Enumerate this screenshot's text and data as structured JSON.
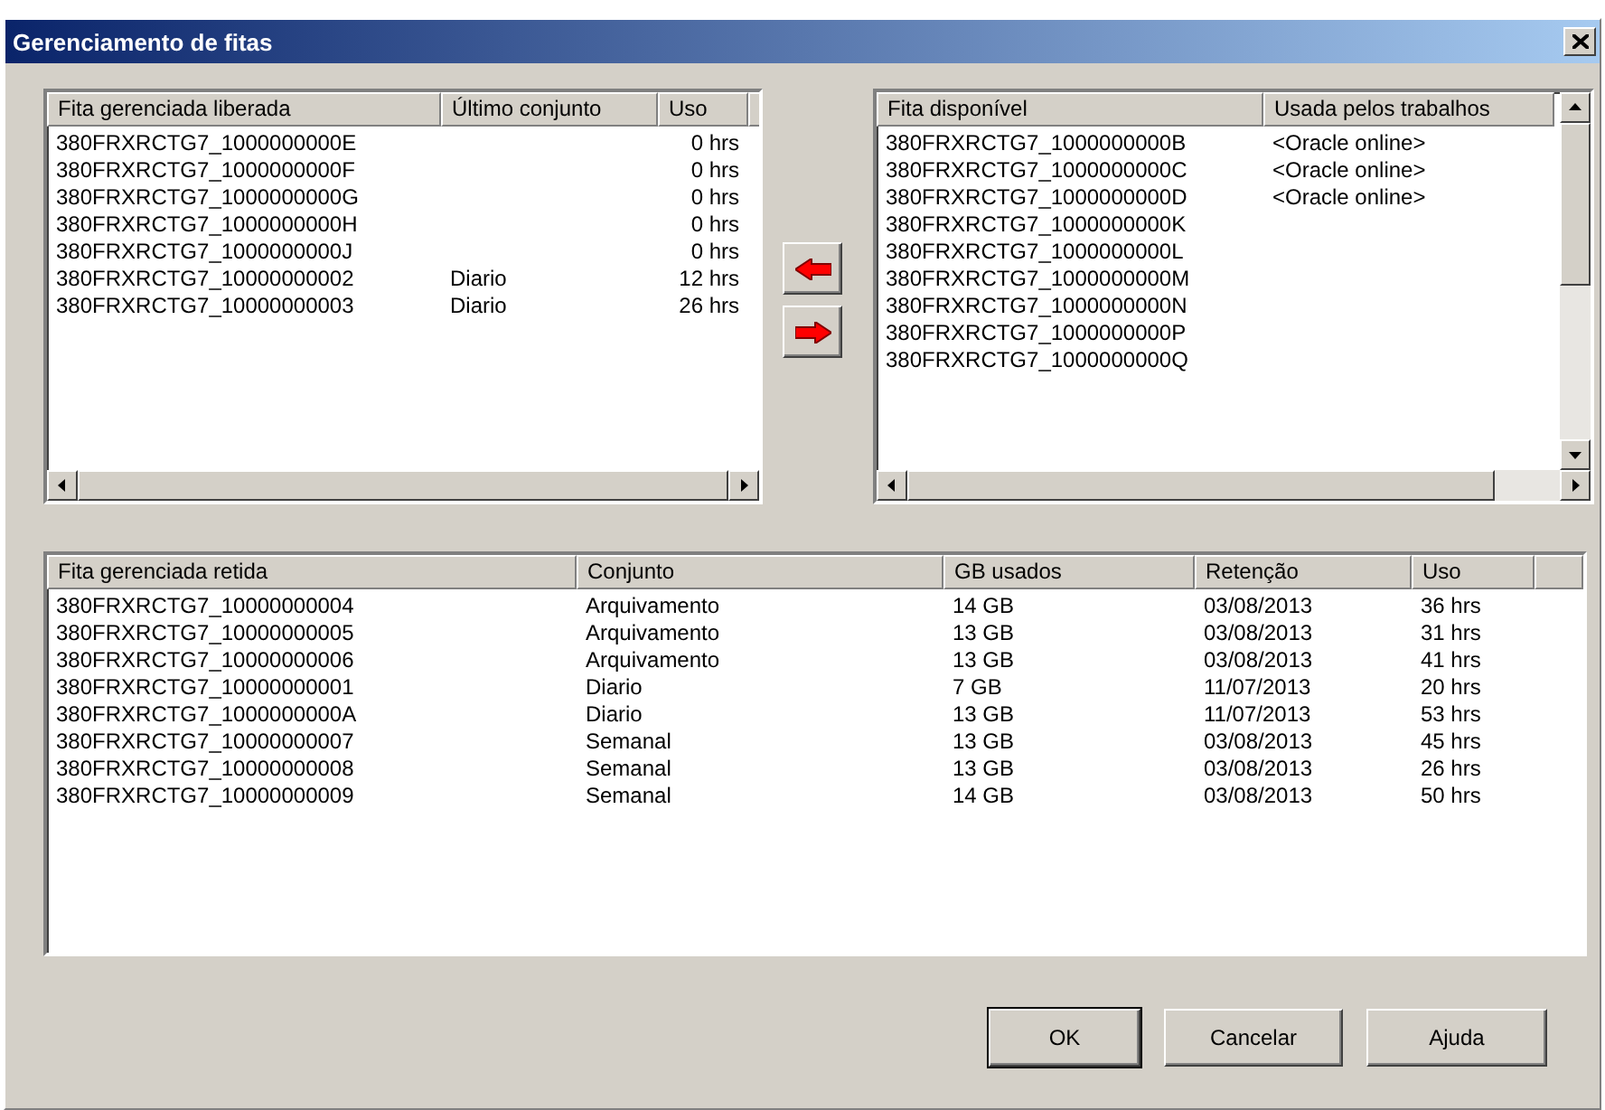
{
  "window": {
    "title": "Gerenciamento de fitas"
  },
  "released_list": {
    "columns": [
      "Fita gerenciada liberada",
      "Último conjunto",
      "Uso"
    ],
    "rows": [
      [
        "380FRXRCTG7_1000000000E",
        null,
        "0 hrs"
      ],
      [
        "380FRXRCTG7_1000000000F",
        null,
        "0 hrs"
      ],
      [
        "380FRXRCTG7_1000000000G",
        null,
        "0 hrs"
      ],
      [
        "380FRXRCTG7_1000000000H",
        null,
        "0 hrs"
      ],
      [
        "380FRXRCTG7_1000000000J",
        null,
        "0 hrs"
      ],
      [
        "380FRXRCTG7_10000000002",
        "Diario",
        "12 hrs"
      ],
      [
        "380FRXRCTG7_10000000003",
        "Diario",
        "26 hrs"
      ]
    ]
  },
  "available_list": {
    "columns": [
      "Fita disponível",
      "Usada pelos trabalhos"
    ],
    "rows": [
      [
        "380FRXRCTG7_1000000000B",
        "<Oracle online>"
      ],
      [
        "380FRXRCTG7_1000000000C",
        "<Oracle online>"
      ],
      [
        "380FRXRCTG7_1000000000D",
        "<Oracle online>"
      ],
      [
        "380FRXRCTG7_1000000000K",
        null
      ],
      [
        "380FRXRCTG7_1000000000L",
        null
      ],
      [
        "380FRXRCTG7_1000000000M",
        null
      ],
      [
        "380FRXRCTG7_1000000000N",
        null
      ],
      [
        "380FRXRCTG7_1000000000P",
        null
      ],
      [
        "380FRXRCTG7_1000000000Q",
        null
      ]
    ]
  },
  "retained_list": {
    "columns": [
      "Fita gerenciada retida",
      "Conjunto",
      "GB usados",
      "Retenção",
      "Uso"
    ],
    "rows": [
      [
        "380FRXRCTG7_10000000004",
        "Arquivamento",
        "14 GB",
        "03/08/2013",
        "36 hrs"
      ],
      [
        "380FRXRCTG7_10000000005",
        "Arquivamento",
        "13 GB",
        "03/08/2013",
        "31 hrs"
      ],
      [
        "380FRXRCTG7_10000000006",
        "Arquivamento",
        "13 GB",
        "03/08/2013",
        "41 hrs"
      ],
      [
        "380FRXRCTG7_10000000001",
        "Diario",
        "7 GB",
        "11/07/2013",
        "20 hrs"
      ],
      [
        "380FRXRCTG7_1000000000A",
        "Diario",
        "13 GB",
        "11/07/2013",
        "53 hrs"
      ],
      [
        "380FRXRCTG7_10000000007",
        "Semanal",
        "13 GB",
        "03/08/2013",
        "45 hrs"
      ],
      [
        "380FRXRCTG7_10000000008",
        "Semanal",
        "13 GB",
        "03/08/2013",
        "26 hrs"
      ],
      [
        "380FRXRCTG7_10000000009",
        "Semanal",
        "14 GB",
        "03/08/2013",
        "50 hrs"
      ]
    ]
  },
  "buttons": [
    {
      "label": "OK",
      "default": true
    },
    {
      "label": "Cancelar",
      "default": false
    },
    {
      "label": "Ajuda",
      "default": false
    }
  ]
}
